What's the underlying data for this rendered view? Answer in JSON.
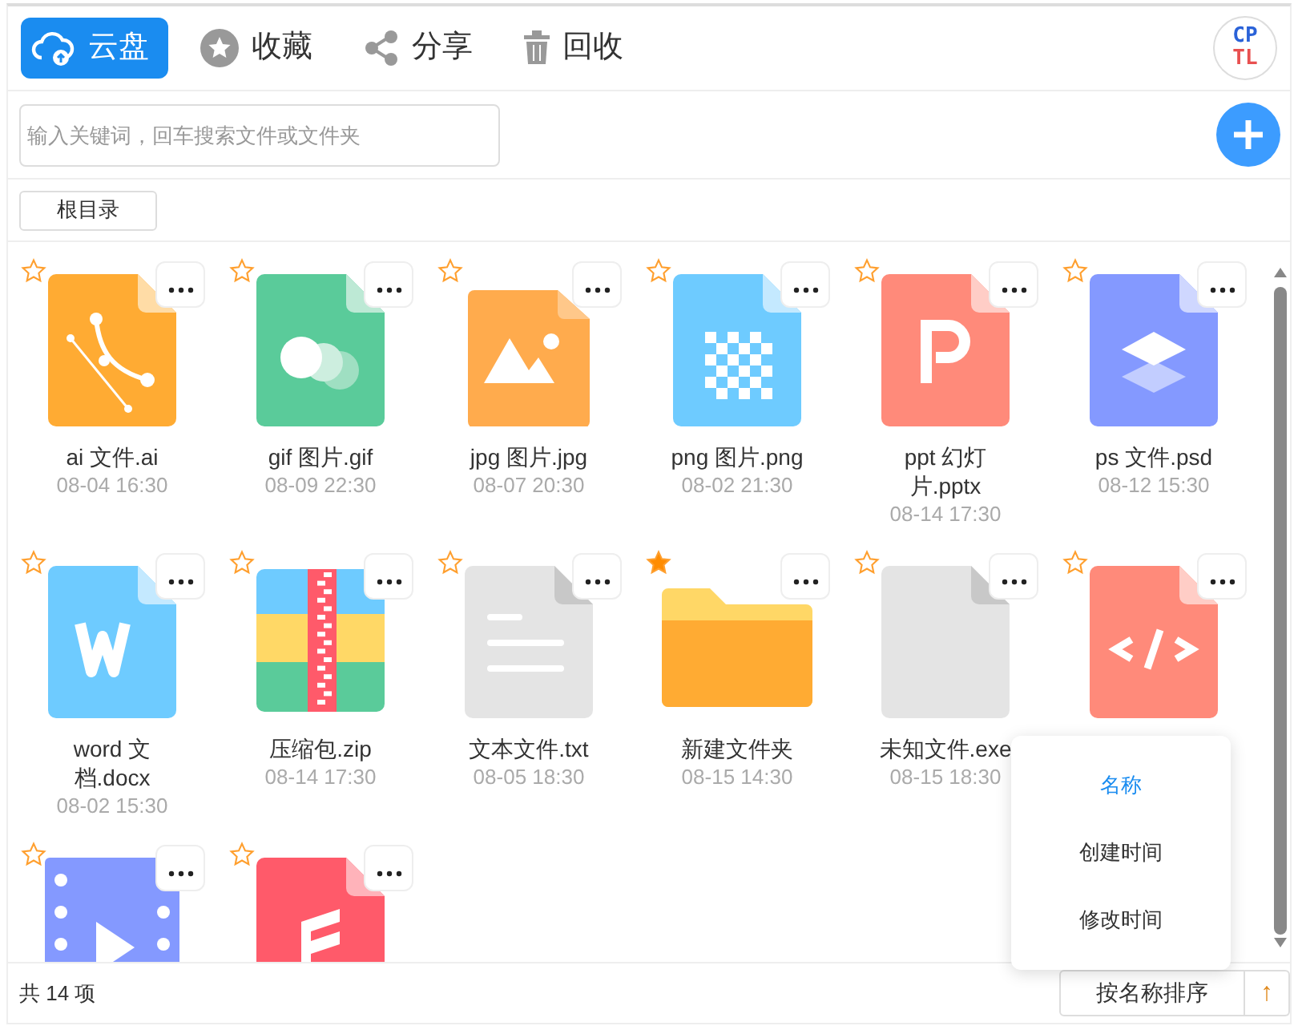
{
  "tabs": [
    {
      "label": "云盘",
      "selected": true
    },
    {
      "label": "收藏",
      "selected": false
    },
    {
      "label": "分享",
      "selected": false
    },
    {
      "label": "回收",
      "selected": false
    }
  ],
  "logo": {
    "line_1": "CP",
    "line_2": "TL"
  },
  "search": {
    "placeholder": "输入关键词，回车搜索文件或文件夹"
  },
  "breadcrumb": [
    "根目录"
  ],
  "files": [
    {
      "kind": "ai",
      "name": "ai 文件.ai",
      "date": "08-04 16:30",
      "starred": false
    },
    {
      "kind": "gif",
      "name": "gif 图片.gif",
      "date": "08-09 22:30",
      "starred": false
    },
    {
      "kind": "jpg",
      "name": "jpg 图片.jpg",
      "date": "08-07 20:30",
      "starred": false
    },
    {
      "kind": "png",
      "name": "png 图片.png",
      "date": "08-02 21:30",
      "starred": false
    },
    {
      "kind": "ppt",
      "name": "ppt 幻灯片.pptx",
      "date": "08-14 17:30",
      "starred": false
    },
    {
      "kind": "psd",
      "name": "ps 文件.psd",
      "date": "08-12 15:30",
      "starred": false
    },
    {
      "kind": "word",
      "name": "word 文档.docx",
      "date": "08-02 15:30",
      "starred": false
    },
    {
      "kind": "zip",
      "name": "压缩包.zip",
      "date": "08-14 17:30",
      "starred": false
    },
    {
      "kind": "txt",
      "name": "文本文件.txt",
      "date": "08-05 18:30",
      "starred": false
    },
    {
      "kind": "folder",
      "name": "新建文件夹",
      "date": "08-15 14:30",
      "starred": true
    },
    {
      "kind": "unknown",
      "name": "未知文件.exe",
      "date": "08-15 18:30",
      "starred": false
    },
    {
      "kind": "code",
      "starred": false
    },
    {
      "kind": "video",
      "starred": false
    },
    {
      "kind": "audio",
      "starred": false
    }
  ],
  "footer": {
    "count": "共 14 项",
    "sort_button": "按名称排序",
    "order_button": "↑"
  },
  "sort_menu": [
    {
      "label": "名称",
      "selected": true
    },
    {
      "label": "创建时间",
      "selected": false
    },
    {
      "label": "修改时间",
      "selected": false
    }
  ]
}
